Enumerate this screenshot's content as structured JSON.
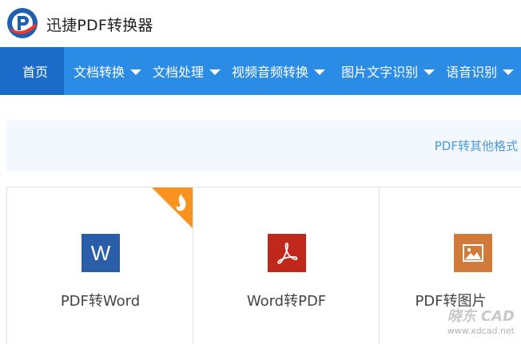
{
  "app": {
    "title": "迅捷PDF转换器"
  },
  "nav": {
    "items": [
      {
        "label": "首页",
        "active": true,
        "dropdown": false
      },
      {
        "label": "文档转换",
        "active": false,
        "dropdown": true
      },
      {
        "label": "文档处理",
        "active": false,
        "dropdown": true
      },
      {
        "label": "视频音频转换",
        "active": false,
        "dropdown": true
      },
      {
        "label": "图片文字识别",
        "active": false,
        "dropdown": true
      },
      {
        "label": "语音识别",
        "active": false,
        "dropdown": true
      }
    ]
  },
  "subbar": {
    "link": "PDF转其他格式"
  },
  "cards": [
    {
      "label": "PDF转Word",
      "icon": "word-icon",
      "icon_letter": "W",
      "color": "#2a5ea8",
      "hot": true
    },
    {
      "label": "Word转PDF",
      "icon": "pdf-icon",
      "color": "#c0281c",
      "hot": false
    },
    {
      "label": "PDF转图片",
      "icon": "image-icon",
      "color": "#d17a3a",
      "hot": false
    }
  ],
  "watermark": {
    "main": "晓东 CAD",
    "url": "www.xdcad.net"
  },
  "colors": {
    "nav_bg": "#2b8ce6",
    "nav_active": "#1b6cc9",
    "accent_link": "#4a9ad8",
    "hot_badge": "#f7931e"
  }
}
